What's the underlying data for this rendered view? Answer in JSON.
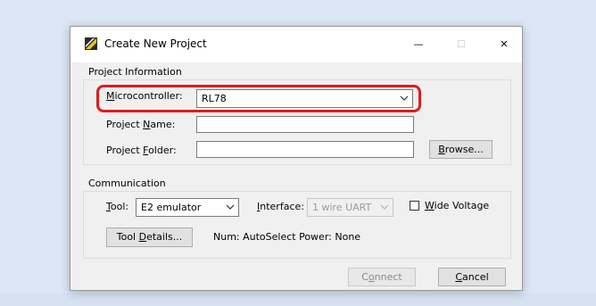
{
  "window": {
    "title": "Create New Project",
    "minimize_glyph": "—",
    "maximize_glyph": "☐",
    "close_glyph": "✕"
  },
  "project_info": {
    "group_label": "Project Information",
    "microcontroller": {
      "label_ul": "M",
      "label_rest": "icrocontroller:",
      "value": "RL78"
    },
    "project_name": {
      "label_pre": "Project ",
      "label_ul": "N",
      "label_post": "ame:",
      "value": ""
    },
    "project_folder": {
      "label_pre": "Project ",
      "label_ul": "F",
      "label_post": "older:",
      "value": ""
    },
    "browse": {
      "label_ul": "B",
      "label_rest": "rowse..."
    }
  },
  "communication": {
    "group_label": "Communication",
    "tool": {
      "label_ul": "T",
      "label_rest": "ool:",
      "value": "E2 emulator"
    },
    "interface": {
      "label_ul": "I",
      "label_rest": "nterface:",
      "value": "1 wire UART"
    },
    "wide_voltage": {
      "label_ul": "W",
      "label_rest": "ide Voltage",
      "checked": false
    },
    "tool_details": {
      "label_pre": "Tool ",
      "label_ul": "D",
      "label_post": "etails..."
    },
    "status_text": "Num: AutoSelect  Power: None"
  },
  "buttons": {
    "connect": {
      "label_pre": "C",
      "label_ul": "o",
      "label_post": "nnect"
    },
    "cancel": {
      "label_ul": "C",
      "label_rest": "ancel"
    }
  },
  "colors": {
    "highlight": "#e01b1b",
    "background": "#dbe7f5",
    "dialog": "#f0f0f0"
  }
}
